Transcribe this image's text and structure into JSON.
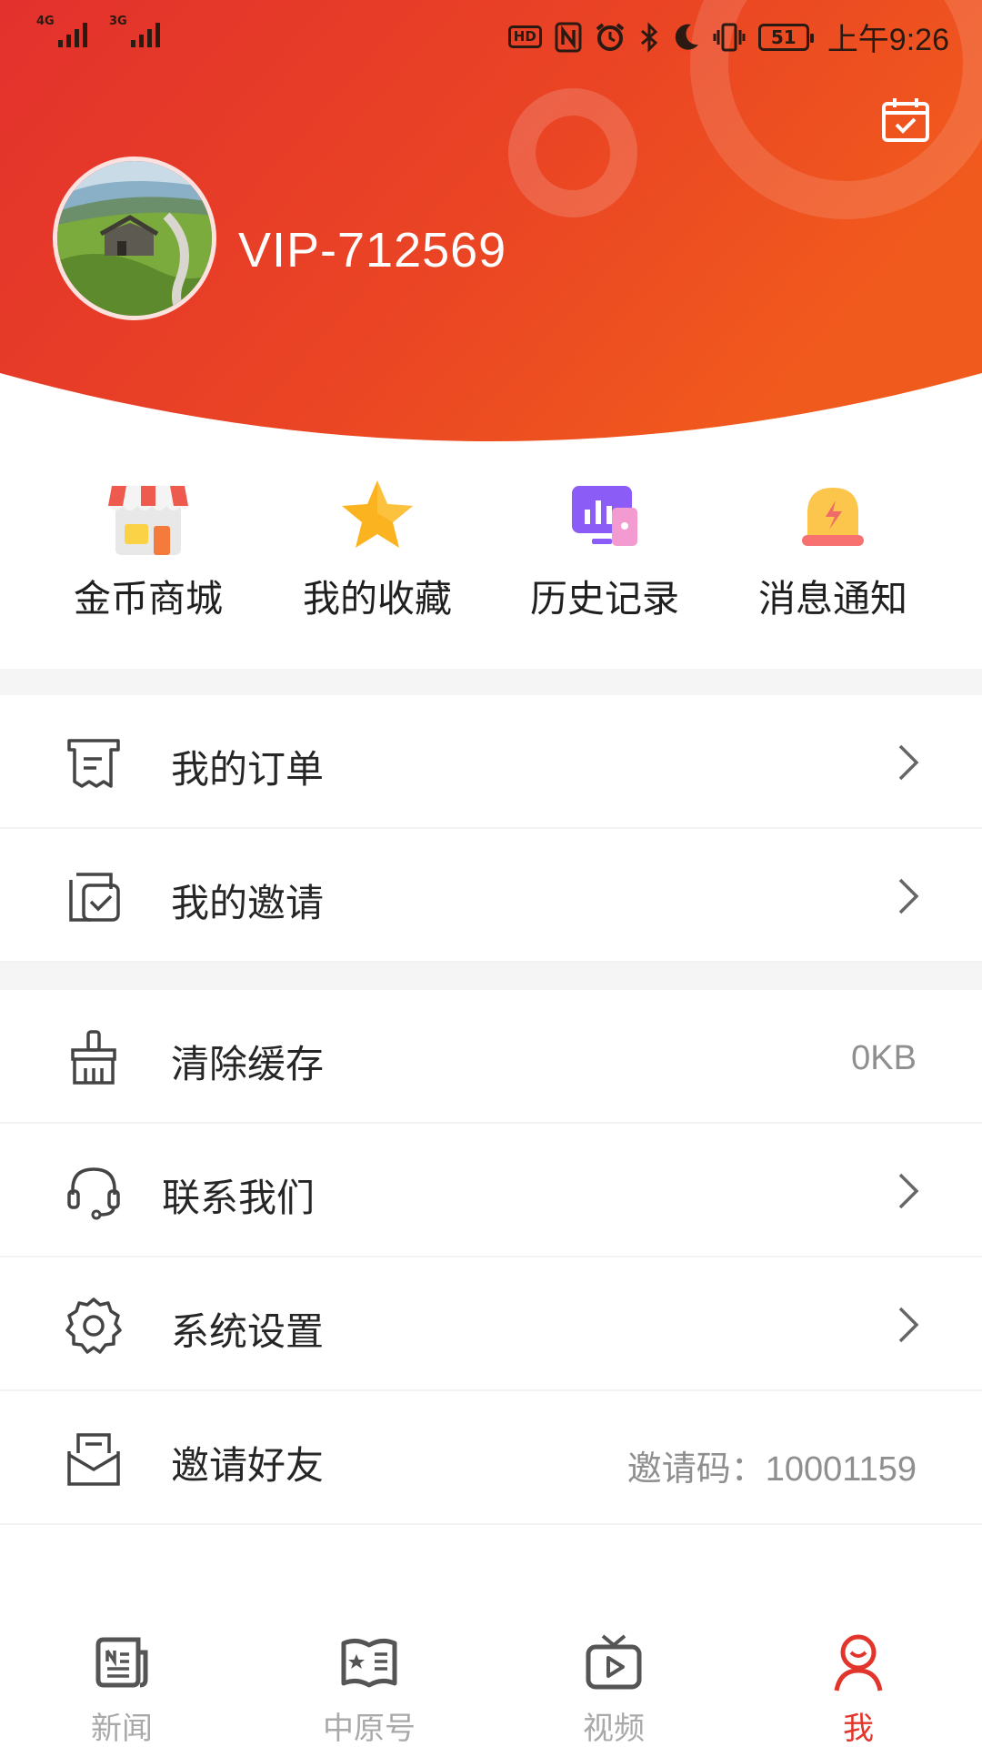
{
  "status_bar": {
    "signal_1": "4G",
    "signal_2": "3G",
    "hd": "HD",
    "nfc": "N",
    "battery": "51",
    "time": "上午9:26",
    "icons": [
      "hd-icon",
      "nfc-icon",
      "alarm-icon",
      "bluetooth-icon",
      "moon-icon",
      "vibrate-icon",
      "battery-icon"
    ]
  },
  "header": {
    "username": "VIP-712569",
    "gradient": [
      "#e8322c",
      "#f0541f"
    ],
    "calendar_icon": "calendar-check-icon"
  },
  "quick_actions": [
    {
      "label": "金币商城",
      "icon": "shop-icon"
    },
    {
      "label": "我的收藏",
      "icon": "star-icon"
    },
    {
      "label": "历史记录",
      "icon": "history-icon"
    },
    {
      "label": "消息通知",
      "icon": "bell-icon"
    }
  ],
  "menu": {
    "orders": {
      "label": "我的订单",
      "icon": "receipt-icon"
    },
    "invites": {
      "label": "我的邀请",
      "icon": "invite-check-icon"
    },
    "cache": {
      "label": "清除缓存",
      "icon": "broom-icon",
      "value": "0KB"
    },
    "contact": {
      "label": "联系我们",
      "icon": "headset-icon"
    },
    "settings": {
      "label": "系统设置",
      "icon": "gear-icon"
    },
    "invite_friends": {
      "label": "邀请好友",
      "icon": "envelope-icon",
      "value": "邀请码：10001159"
    }
  },
  "tabs": [
    {
      "label": "新闻",
      "icon": "news-icon",
      "active": false
    },
    {
      "label": "中原号",
      "icon": "book-star-icon",
      "active": false
    },
    {
      "label": "视频",
      "icon": "tv-play-icon",
      "active": false
    },
    {
      "label": "我",
      "icon": "person-icon",
      "active": true
    }
  ],
  "colors": {
    "accent": "#e2352c",
    "text": "#262626",
    "muted": "#8f8f8f",
    "tab_inactive": "#a9a9a9"
  }
}
